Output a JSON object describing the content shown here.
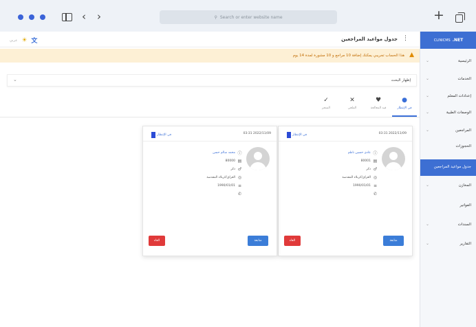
{
  "browser": {
    "address_placeholder": "Search or enter website name",
    "new_tab_label": "+"
  },
  "header": {
    "page_title": "جدول مواعيد المراجعين",
    "lang_label": "عربي"
  },
  "alert": {
    "text": "هذا الحساب تجريبي يمكنك إضافة 10 مراجع و 10 مشورة لمدة 14 يوم"
  },
  "filter": {
    "label": "إظهار البحث"
  },
  "status_tabs": [
    {
      "label": "في الإنتظار",
      "icon": "clock-icon",
      "glyph": "●"
    },
    {
      "label": "قيد المعالجة",
      "icon": "heart-icon",
      "glyph": "♥"
    },
    {
      "label": "الملغي",
      "icon": "x-icon",
      "glyph": "✕"
    },
    {
      "label": "المنجز",
      "icon": "check-icon",
      "glyph": "✓"
    }
  ],
  "cards": [
    {
      "date": "03:31 2022/11/09",
      "status": "في الإنتظار",
      "name": "عادي حسين ناظم",
      "id": "80001",
      "gender": "ذكر",
      "address": "العراق/كربلاء المقدسة",
      "birth": "1990/01/01",
      "phone": "",
      "follow_label": "متابعة",
      "cancel_label": "الغاء"
    },
    {
      "date": "03:31 2022/11/09",
      "status": "في الإنتظار",
      "name": "محمد سالم حسن",
      "id": "80000",
      "gender": "ذكر",
      "address": "العراق/كربلاء المقدسة",
      "birth": "1990/01/01",
      "phone": "",
      "follow_label": "متابعة",
      "cancel_label": "الغاء"
    }
  ],
  "sidebar": {
    "brand_prefix": "CLINICMS",
    "brand_suffix": ".NET",
    "items": [
      {
        "label": "الرئيسية",
        "expandable": true,
        "active": false
      },
      {
        "label": "الخدمات",
        "expandable": true,
        "active": false
      },
      {
        "label": "إعدادات المعلم",
        "expandable": true,
        "active": false
      },
      {
        "label": "الوصفات الطبية",
        "expandable": true,
        "active": false
      },
      {
        "label": "المراجعين",
        "expandable": true,
        "active": false
      },
      {
        "label": "الحجوزات",
        "expandable": false,
        "active": false
      },
      {
        "label": "جدول مواعيد المراجعين",
        "expandable": false,
        "active": true
      },
      {
        "label": "المخازن",
        "expandable": true,
        "active": false
      },
      {
        "label": "الفواتير",
        "expandable": false,
        "active": false
      },
      {
        "label": "السندات",
        "expandable": true,
        "active": false
      },
      {
        "label": "التقارير",
        "expandable": true,
        "active": false
      }
    ]
  },
  "colors": {
    "accent": "#3d6fd3",
    "alert_bg": "#fdf0d5",
    "cancel": "#e03a3a",
    "window_dot": "#3b63d8"
  }
}
